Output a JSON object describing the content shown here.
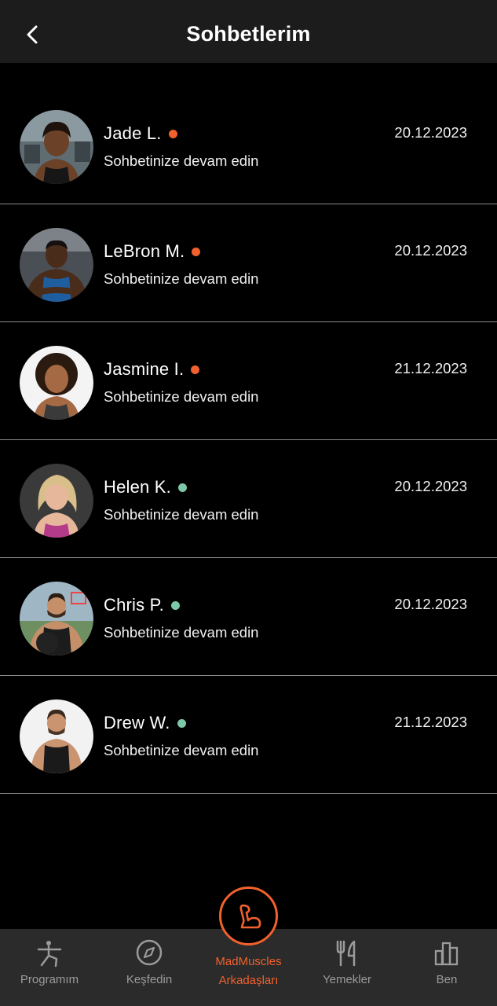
{
  "header": {
    "title": "Sohbetlerim",
    "back_icon": "chevron-left-icon"
  },
  "colors": {
    "accent": "#f0612d",
    "online_green": "#7cc8a8",
    "background": "#000000",
    "header_bg": "#1c1c1c",
    "nav_bg": "#2b2b2b"
  },
  "chats": [
    {
      "name": "Jade L.",
      "status": "orange",
      "subtitle": "Sohbetinize devam edin",
      "date": "20.12.2023"
    },
    {
      "name": "LeBron M.",
      "status": "orange",
      "subtitle": "Sohbetinize devam edin",
      "date": "20.12.2023"
    },
    {
      "name": "Jasmine I.",
      "status": "orange",
      "subtitle": "Sohbetinize devam edin",
      "date": "21.12.2023"
    },
    {
      "name": "Helen K.",
      "status": "green",
      "subtitle": "Sohbetinize devam edin",
      "date": "20.12.2023"
    },
    {
      "name": "Chris P.",
      "status": "green",
      "subtitle": "Sohbetinize devam edin",
      "date": "20.12.2023"
    },
    {
      "name": "Drew W.",
      "status": "green",
      "subtitle": "Sohbetinize devam edin",
      "date": "21.12.2023"
    }
  ],
  "nav": {
    "programim": {
      "label": "Programım",
      "icon": "figure-icon"
    },
    "kesfedin": {
      "label": "Keşfedin",
      "icon": "compass-icon"
    },
    "center": {
      "label_line1": "MadMuscles",
      "label_line2": "Arkadaşları",
      "icon": "flexed-arm-icon"
    },
    "yemekler": {
      "label": "Yemekler",
      "icon": "fork-knife-icon"
    },
    "ben": {
      "label": "Ben",
      "icon": "bar-chart-icon"
    }
  }
}
